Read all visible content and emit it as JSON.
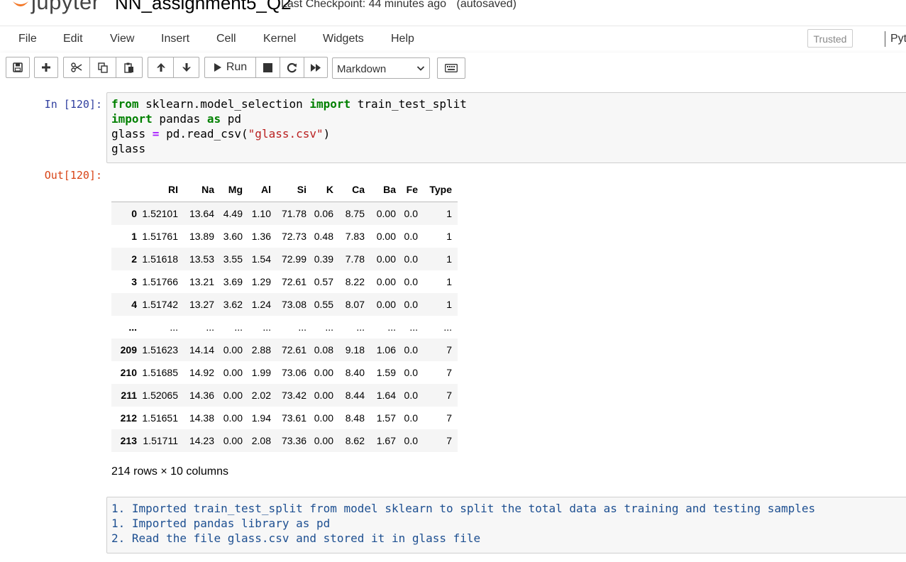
{
  "header": {
    "logo_text": "jupyter",
    "notebook_name": "NN_assignment5_Q2",
    "checkpoint_text": "Last Checkpoint: 44 minutes ago",
    "autosave_text": "(autosaved)"
  },
  "menubar": {
    "items": [
      "File",
      "Edit",
      "View",
      "Insert",
      "Cell",
      "Kernel",
      "Widgets",
      "Help"
    ],
    "trusted_label": "Trusted",
    "kernel_name": "Pyt"
  },
  "toolbar": {
    "icons": [
      "save-icon",
      "plus-icon",
      "scissors-icon",
      "copy-icon",
      "paste-icon",
      "arrow-up-icon",
      "arrow-down-icon",
      "play-icon",
      "stop-icon",
      "restart-icon",
      "fast-forward-icon",
      "keyboard-icon"
    ],
    "run_label": "Run",
    "cell_type": "Markdown"
  },
  "cells": {
    "in_prompt": "In [120]:",
    "out_prompt": "Out[120]:",
    "code": {
      "line1": {
        "kw1": "from",
        "mod": " sklearn.model_selection ",
        "kw2": "import",
        "name": " train_test_split"
      },
      "line2": {
        "kw1": "import",
        "mod": " pandas ",
        "kw2": "as",
        "name": " pd"
      },
      "line3": {
        "lhs": "glass ",
        "op": "=",
        "call": " pd.read_csv(",
        "str": "\"glass.csv\"",
        "close": ")"
      },
      "line4": "glass"
    },
    "dataframe": {
      "columns": [
        "",
        "RI",
        "Na",
        "Mg",
        "Al",
        "Si",
        "K",
        "Ca",
        "Ba",
        "Fe",
        "Type"
      ],
      "rows": [
        [
          "0",
          "1.52101",
          "13.64",
          "4.49",
          "1.10",
          "71.78",
          "0.06",
          "8.75",
          "0.00",
          "0.0",
          "1"
        ],
        [
          "1",
          "1.51761",
          "13.89",
          "3.60",
          "1.36",
          "72.73",
          "0.48",
          "7.83",
          "0.00",
          "0.0",
          "1"
        ],
        [
          "2",
          "1.51618",
          "13.53",
          "3.55",
          "1.54",
          "72.99",
          "0.39",
          "7.78",
          "0.00",
          "0.0",
          "1"
        ],
        [
          "3",
          "1.51766",
          "13.21",
          "3.69",
          "1.29",
          "72.61",
          "0.57",
          "8.22",
          "0.00",
          "0.0",
          "1"
        ],
        [
          "4",
          "1.51742",
          "13.27",
          "3.62",
          "1.24",
          "73.08",
          "0.55",
          "8.07",
          "0.00",
          "0.0",
          "1"
        ],
        [
          "...",
          "...",
          "...",
          "...",
          "...",
          "...",
          "...",
          "...",
          "...",
          "...",
          "..."
        ],
        [
          "209",
          "1.51623",
          "14.14",
          "0.00",
          "2.88",
          "72.61",
          "0.08",
          "9.18",
          "1.06",
          "0.0",
          "7"
        ],
        [
          "210",
          "1.51685",
          "14.92",
          "0.00",
          "1.99",
          "73.06",
          "0.00",
          "8.40",
          "1.59",
          "0.0",
          "7"
        ],
        [
          "211",
          "1.52065",
          "14.36",
          "0.00",
          "2.02",
          "73.42",
          "0.00",
          "8.44",
          "1.64",
          "0.0",
          "7"
        ],
        [
          "212",
          "1.51651",
          "14.38",
          "0.00",
          "1.94",
          "73.61",
          "0.00",
          "8.48",
          "1.57",
          "0.0",
          "7"
        ],
        [
          "213",
          "1.51711",
          "14.23",
          "0.00",
          "2.08",
          "73.36",
          "0.00",
          "8.62",
          "1.67",
          "0.0",
          "7"
        ]
      ],
      "shape_text": "214 rows × 10 columns"
    },
    "markdown_lines": [
      "1. Imported train_test_split from model sklearn to split the total data as training and testing samples",
      "1. Imported pandas library as pd",
      "2. Read the file glass.csv and stored it in glass file"
    ]
  },
  "colors": {
    "in_prompt": "#303f9f",
    "out_prompt": "#d84315",
    "keyword": "#008000",
    "string": "#ba2121",
    "operator": "#aa22ff",
    "logo_orange": "#f37726"
  }
}
